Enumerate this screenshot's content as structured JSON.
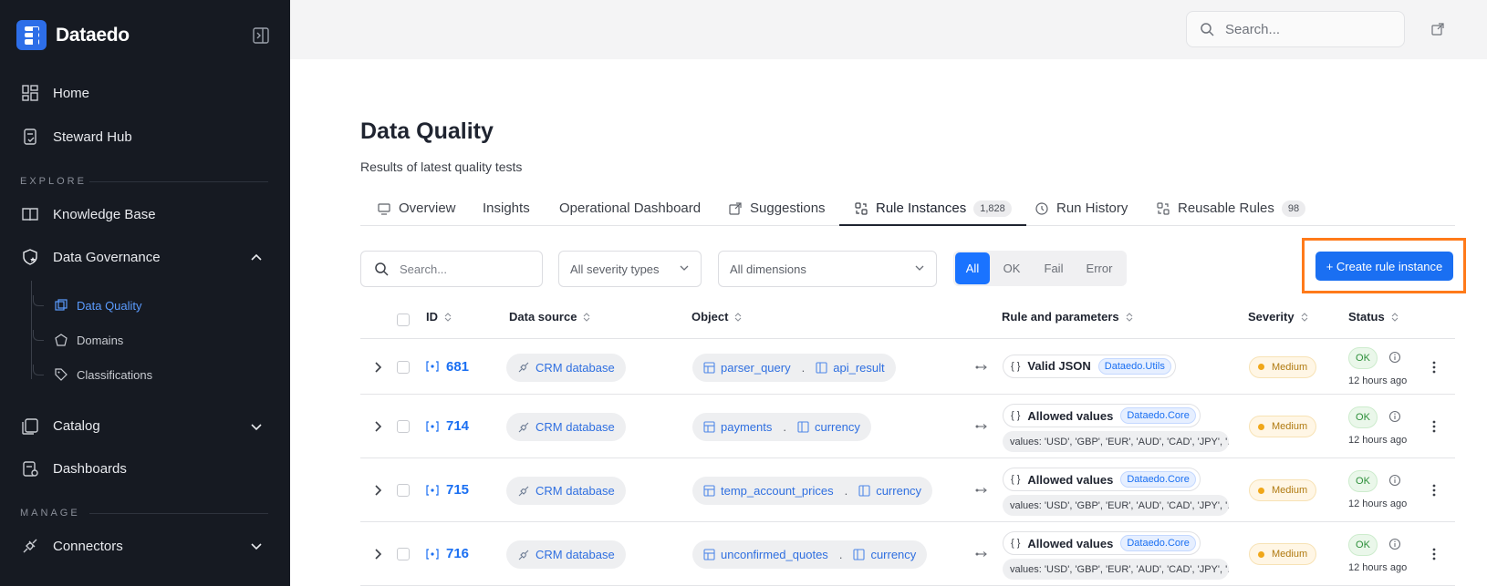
{
  "app": {
    "name": "Dataedo"
  },
  "sidebar": {
    "items": [
      {
        "label": "Home",
        "icon": "grid-icon"
      },
      {
        "label": "Steward Hub",
        "icon": "clipboard-check-icon"
      }
    ],
    "explore_label": "EXPLORE",
    "explore_items": [
      {
        "label": "Knowledge Base",
        "icon": "book-icon"
      },
      {
        "label": "Data Governance",
        "icon": "shield-star-icon"
      }
    ],
    "governance_children": [
      {
        "label": "Data Quality",
        "icon": "data-quality-icon",
        "active": true
      },
      {
        "label": "Domains",
        "icon": "domain-icon"
      },
      {
        "label": "Classifications",
        "icon": "tag-icon"
      }
    ],
    "more_items": [
      {
        "label": "Catalog",
        "icon": "catalog-icon"
      },
      {
        "label": "Dashboards",
        "icon": "dashboard-icon"
      }
    ],
    "manage_label": "MANAGE",
    "manage_items": [
      {
        "label": "Connectors",
        "icon": "plug-icon"
      }
    ]
  },
  "topbar": {
    "search_placeholder": "Search..."
  },
  "page": {
    "title": "Data Quality",
    "subtitle": "Results of latest quality tests"
  },
  "tabs": [
    {
      "label": "Overview",
      "icon": "monitor-icon"
    },
    {
      "label": "Insights"
    },
    {
      "label": "Operational Dashboard"
    },
    {
      "label": "Suggestions",
      "icon": "external-link-icon"
    },
    {
      "label": "Rule Instances",
      "icon": "rule-icon",
      "count": "1,828",
      "active": true
    },
    {
      "label": "Run History",
      "icon": "history-icon"
    },
    {
      "label": "Reusable Rules",
      "icon": "rule-icon",
      "count": "98"
    }
  ],
  "filters": {
    "search_placeholder": "Search...",
    "severity": "All severity types",
    "dimensions": "All dimensions",
    "segments": [
      "All",
      "OK",
      "Fail",
      "Error"
    ],
    "active_segment": "All",
    "create_label": "+ Create rule instance"
  },
  "table": {
    "columns": [
      "ID",
      "Data source",
      "Object",
      "Rule and parameters",
      "Severity",
      "Status"
    ],
    "rows": [
      {
        "id": "681",
        "source": "CRM database",
        "table": "parser_query",
        "column": "api_result",
        "rule": "Valid JSON",
        "lib": "Dataedo.Utils",
        "params": "",
        "severity": "Medium",
        "status": "OK",
        "ago": "12 hours ago"
      },
      {
        "id": "714",
        "source": "CRM database",
        "table": "payments",
        "column": "currency",
        "rule": "Allowed values",
        "lib": "Dataedo.Core",
        "params": "values: 'USD', 'GBP', 'EUR', 'AUD', 'CAD', 'JPY', '...",
        "severity": "Medium",
        "status": "OK",
        "ago": "12 hours ago"
      },
      {
        "id": "715",
        "source": "CRM database",
        "table": "temp_account_prices",
        "column": "currency",
        "rule": "Allowed values",
        "lib": "Dataedo.Core",
        "params": "values: 'USD', 'GBP', 'EUR', 'AUD', 'CAD', 'JPY', '...",
        "severity": "Medium",
        "status": "OK",
        "ago": "12 hours ago"
      },
      {
        "id": "716",
        "source": "CRM database",
        "table": "unconfirmed_quotes",
        "column": "currency",
        "rule": "Allowed values",
        "lib": "Dataedo.Core",
        "params": "values: 'USD', 'GBP', 'EUR', 'AUD', 'CAD', 'JPY', '...",
        "severity": "Medium",
        "status": "OK",
        "ago": "12 hours ago"
      }
    ]
  },
  "colors": {
    "sidebar_bg": "#161a22",
    "accent": "#1a6ff2",
    "highlight_box": "#ff7a1a",
    "severity_medium": "#f0a71a",
    "status_ok": "#2d8f3a"
  }
}
